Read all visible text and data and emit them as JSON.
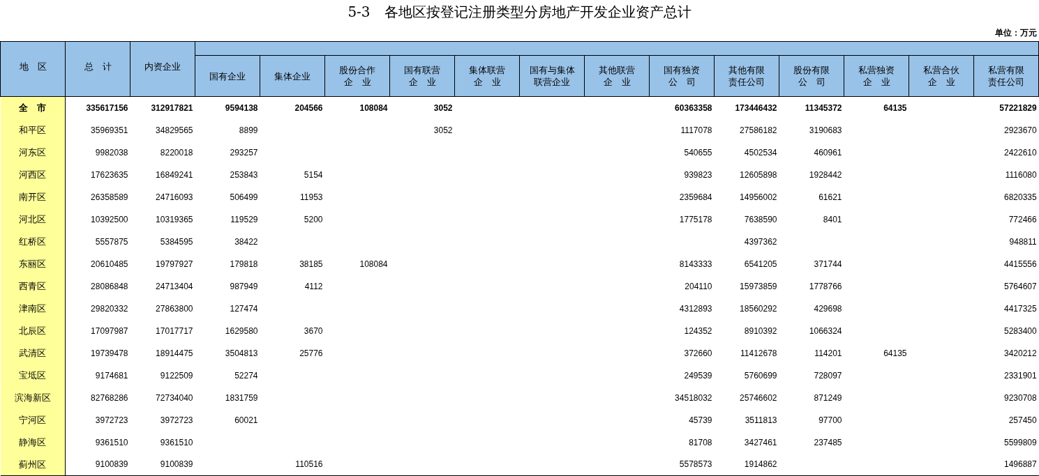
{
  "title": "5-3　各地区按登记注册类型分房地产开发企业资产总计",
  "unit": "单位：万元",
  "table": {
    "columns": [
      [
        "地　区"
      ],
      [
        "总　计"
      ],
      [
        "内资企业"
      ],
      [
        "国有企业"
      ],
      [
        "集体企业"
      ],
      [
        "股份合作",
        "企　业"
      ],
      [
        "国有联营",
        "企　业"
      ],
      [
        "集体联营",
        "企　业"
      ],
      [
        "国有与集体",
        "联营企业"
      ],
      [
        "其他联营",
        "企　业"
      ],
      [
        "国有独资",
        "公　司"
      ],
      [
        "其他有限",
        "责任公司"
      ],
      [
        "股份有限",
        "公　司"
      ],
      [
        "私营独资",
        "企　业"
      ],
      [
        "私营合伙",
        "企　业"
      ],
      [
        "私营有限",
        "责任公司"
      ]
    ],
    "rows": [
      {
        "kind": "total",
        "region": "全　市",
        "values": {
          "total": "335617156",
          "domestic": "312917821",
          "state_owned": "9594138",
          "collective": "204566",
          "joint_stock_coop": "108084",
          "state_joint": "3052",
          "state_sole": "60363358",
          "other_llc": "173446432",
          "stock_ltd": "11345372",
          "private_sole": "64135",
          "private_llc": "57221829"
        }
      },
      {
        "kind": "district",
        "region": "和平区",
        "values": {
          "total": "35969351",
          "domestic": "34829565",
          "state_owned": "8899",
          "state_joint": "3052",
          "state_sole": "1117078",
          "other_llc": "27586182",
          "stock_ltd": "3190683",
          "private_llc": "2923670"
        }
      },
      {
        "kind": "district",
        "region": "河东区",
        "values": {
          "total": "9982038",
          "domestic": "8220018",
          "state_owned": "293257",
          "state_sole": "540655",
          "other_llc": "4502534",
          "stock_ltd": "460961",
          "private_llc": "2422610"
        }
      },
      {
        "kind": "district",
        "region": "河西区",
        "values": {
          "total": "17623635",
          "domestic": "16849241",
          "state_owned": "253843",
          "collective": "5154",
          "state_sole": "939823",
          "other_llc": "12605898",
          "stock_ltd": "1928442",
          "private_llc": "1116080"
        }
      },
      {
        "kind": "district",
        "region": "南开区",
        "values": {
          "total": "26358589",
          "domestic": "24716093",
          "state_owned": "506499",
          "collective": "11953",
          "state_sole": "2359684",
          "other_llc": "14956002",
          "stock_ltd": "61621",
          "private_llc": "6820335"
        }
      },
      {
        "kind": "district",
        "region": "河北区",
        "values": {
          "total": "10392500",
          "domestic": "10319365",
          "state_owned": "119529",
          "collective": "5200",
          "state_sole": "1775178",
          "other_llc": "7638590",
          "stock_ltd": "8401",
          "private_llc": "772466"
        }
      },
      {
        "kind": "district",
        "region": "红桥区",
        "values": {
          "total": "5557875",
          "domestic": "5384595",
          "state_owned": "38422",
          "other_llc": "4397362",
          "private_llc": "948811"
        }
      },
      {
        "kind": "district",
        "region": "东丽区",
        "values": {
          "total": "20610485",
          "domestic": "19797927",
          "state_owned": "179818",
          "collective": "38185",
          "joint_stock_coop": "108084",
          "state_sole": "8143333",
          "other_llc": "6541205",
          "stock_ltd": "371744",
          "private_llc": "4415556"
        }
      },
      {
        "kind": "district",
        "region": "西青区",
        "values": {
          "total": "28086848",
          "domestic": "24713404",
          "state_owned": "987949",
          "collective": "4112",
          "state_sole": "204110",
          "other_llc": "15973859",
          "stock_ltd": "1778766",
          "private_llc": "5764607"
        }
      },
      {
        "kind": "district",
        "region": "津南区",
        "values": {
          "total": "29820332",
          "domestic": "27863800",
          "state_owned": "127474",
          "state_sole": "4312893",
          "other_llc": "18560292",
          "stock_ltd": "429698",
          "private_llc": "4417325"
        }
      },
      {
        "kind": "district",
        "region": "北辰区",
        "values": {
          "total": "17097987",
          "domestic": "17017717",
          "state_owned": "1629580",
          "collective": "3670",
          "state_sole": "124352",
          "other_llc": "8910392",
          "stock_ltd": "1066324",
          "private_llc": "5283400"
        }
      },
      {
        "kind": "district",
        "region": "武清区",
        "values": {
          "total": "19739478",
          "domestic": "18914475",
          "state_owned": "3504813",
          "collective": "25776",
          "state_sole": "372660",
          "other_llc": "11412678",
          "stock_ltd": "114201",
          "private_sole": "64135",
          "private_llc": "3420212"
        }
      },
      {
        "kind": "district",
        "region": "宝坻区",
        "values": {
          "total": "9174681",
          "domestic": "9122509",
          "state_owned": "52274",
          "state_sole": "249539",
          "other_llc": "5760699",
          "stock_ltd": "728097",
          "private_llc": "2331901"
        }
      },
      {
        "kind": "district",
        "region": "滨海新区",
        "values": {
          "total": "82768286",
          "domestic": "72734040",
          "state_owned": "1831759",
          "state_sole": "34518032",
          "other_llc": "25746602",
          "stock_ltd": "871249",
          "private_llc": "9230708"
        }
      },
      {
        "kind": "district",
        "region": "宁河区",
        "values": {
          "total": "3972723",
          "domestic": "3972723",
          "state_owned": "60021",
          "state_sole": "45739",
          "other_llc": "3511813",
          "stock_ltd": "97700",
          "private_llc": "257450"
        }
      },
      {
        "kind": "district",
        "region": "静海区",
        "values": {
          "total": "9361510",
          "domestic": "9361510",
          "state_sole": "81708",
          "other_llc": "3427461",
          "stock_ltd": "237485",
          "private_llc": "5599809"
        }
      },
      {
        "kind": "district",
        "region": "蓟州区",
        "values": {
          "total": "9100839",
          "domestic": "9100839",
          "collective": "110516",
          "state_sole": "5578573",
          "other_llc": "1914862",
          "private_llc": "1496887"
        }
      }
    ]
  }
}
